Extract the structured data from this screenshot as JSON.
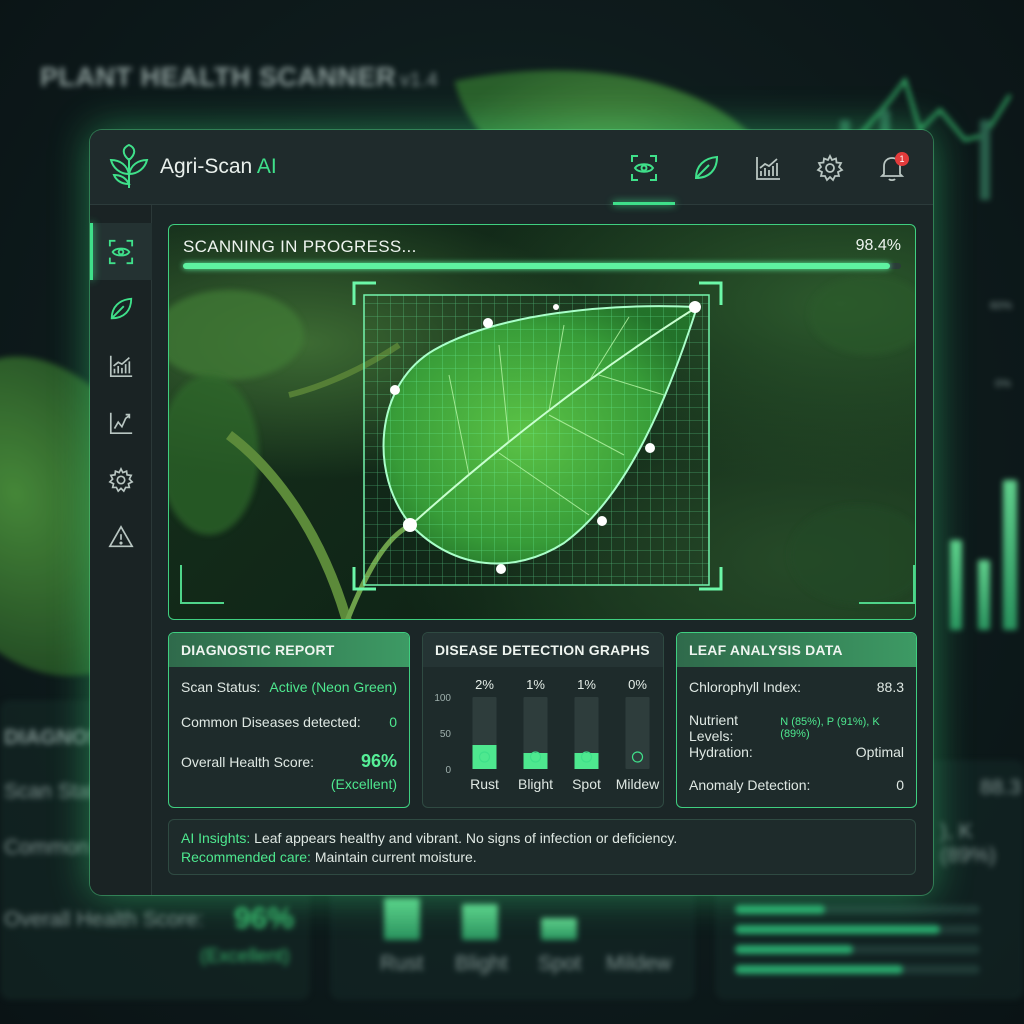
{
  "background": {
    "title": "PLANT HEALTH SCANNER",
    "version": "v1.4",
    "ghost_texts": [
      "DIAGNOS",
      "Scan Stat",
      "Common",
      "Overall Health Score:",
      "96%",
      "(Excellent)",
      "88.3",
      "), K (89%)",
      "Rust",
      "Blight",
      "Spot",
      "Mildew",
      "60%",
      "0%"
    ]
  },
  "app": {
    "brand_prefix": "Agri-Scan ",
    "brand_accent": "AI",
    "notification_count": "1"
  },
  "topnav": [
    {
      "icon": "eye-scan-icon",
      "active": true
    },
    {
      "icon": "leaf-icon",
      "active": false
    },
    {
      "icon": "bar-chart-icon",
      "active": false
    },
    {
      "icon": "gear-icon",
      "active": false
    },
    {
      "icon": "bell-icon",
      "active": false
    }
  ],
  "sidebar": [
    {
      "icon": "eye-scan-icon",
      "active": true
    },
    {
      "icon": "leaf-icon",
      "active": false
    },
    {
      "icon": "bar-chart-icon",
      "active": false
    },
    {
      "icon": "trend-chart-icon",
      "active": false
    },
    {
      "icon": "gear-icon",
      "active": false
    },
    {
      "icon": "warning-icon",
      "active": false
    }
  ],
  "scan": {
    "title": "SCANNING IN PROGRESS...",
    "percent_label": "98.4%",
    "progress": 0.984
  },
  "diagnostic": {
    "title": "DIAGNOSTIC REPORT",
    "status_label": "Scan Status:",
    "status_value": "Active (Neon Green)",
    "diseases_label": "Common Diseases detected:",
    "diseases_value": "0",
    "health_label": "Overall Health Score:",
    "health_value": "96%",
    "health_rating": "(Excellent)"
  },
  "disease_graph": {
    "title": "DISEASE DETECTION GRAPHS"
  },
  "chart_data": {
    "type": "bar",
    "categories": [
      "Rust",
      "Blight",
      "Spot",
      "Mildew"
    ],
    "value_labels": [
      "2%",
      "1%",
      "1%",
      "0%"
    ],
    "yticks": [
      "100",
      "50",
      "0"
    ],
    "ylim": [
      0,
      100
    ]
  },
  "leaf_analysis": {
    "title": "LEAF ANALYSIS DATA",
    "chlorophyll_label": "Chlorophyll Index:",
    "chlorophyll_value": "88.3",
    "nutrient_label": "Nutrient Levels:",
    "nutrient_value": "N (85%), P (91%), K (89%)",
    "hydration_label": "Hydration:",
    "hydration_value": "Optimal",
    "anomaly_label": "Anomaly Detection:",
    "anomaly_value": "0"
  },
  "insights": {
    "label": "AI Insights:",
    "text": " Leaf appears healthy and vibrant. No signs of infection or deficiency.",
    "care_label": "Recommended care:",
    "care_text": " Maintain current moisture."
  },
  "colors": {
    "accent": "#3fe08a",
    "bar": "#4ee88f",
    "alert": "#e23b3b"
  }
}
